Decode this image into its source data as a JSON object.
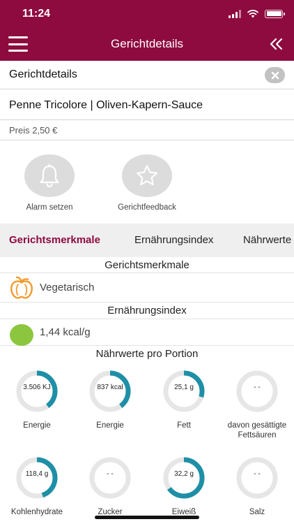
{
  "status_bar": {
    "time": "11:24"
  },
  "header": {
    "title": "Gerichtdetails",
    "menu_icon": "hamburger-menu-icon",
    "collapse_icon": "double-chevron-left-icon"
  },
  "detail": {
    "section_label": "Gerichtdetails",
    "dish_name": "Penne Tricolore | Oliven-Kapern-Sauce",
    "price": "Preis 2,50 €"
  },
  "actions": [
    {
      "label": "Alarm setzen",
      "icon": "bell-icon"
    },
    {
      "label": "Gerichtfeedback",
      "icon": "star-icon"
    }
  ],
  "tabs": [
    {
      "label": "Gerichtsmerkmale",
      "active": true
    },
    {
      "label": "Ernährungsindex",
      "active": false
    },
    {
      "label": "Nährwerte",
      "active": false
    }
  ],
  "features": {
    "title": "Gerichtsmerkmale",
    "items": [
      {
        "label": "Vegetarisch",
        "icon": "bell-pepper-icon",
        "icon_color": "#f39a2b"
      }
    ]
  },
  "nutrition_index": {
    "title": "Ernährungsindex",
    "value": "1,44 kcal/g",
    "indicator_color": "#8cc63f"
  },
  "nutrients": {
    "title": "Nährwerte pro Portion",
    "ring_color": "#1e8fa6",
    "track_color": "#e6e6e6",
    "items": [
      {
        "value": "3.506 KJ",
        "label": "Energie",
        "fraction": 0.4
      },
      {
        "value": "837 kcal",
        "label": "Energie",
        "fraction": 0.4
      },
      {
        "value": "25,1 g",
        "label": "Fett",
        "fraction": 0.3
      },
      {
        "value": "- -",
        "label": "davon gesättigte Fettsäuren",
        "fraction": 0
      },
      {
        "value": "118,4 g",
        "label": "Kohlenhydrate",
        "fraction": 0.45
      },
      {
        "value": "- -",
        "label": "Zucker",
        "fraction": 0
      },
      {
        "value": "32,2 g",
        "label": "Eiweiß",
        "fraction": 0.65
      },
      {
        "value": "- -",
        "label": "Salz",
        "fraction": 0
      }
    ]
  }
}
